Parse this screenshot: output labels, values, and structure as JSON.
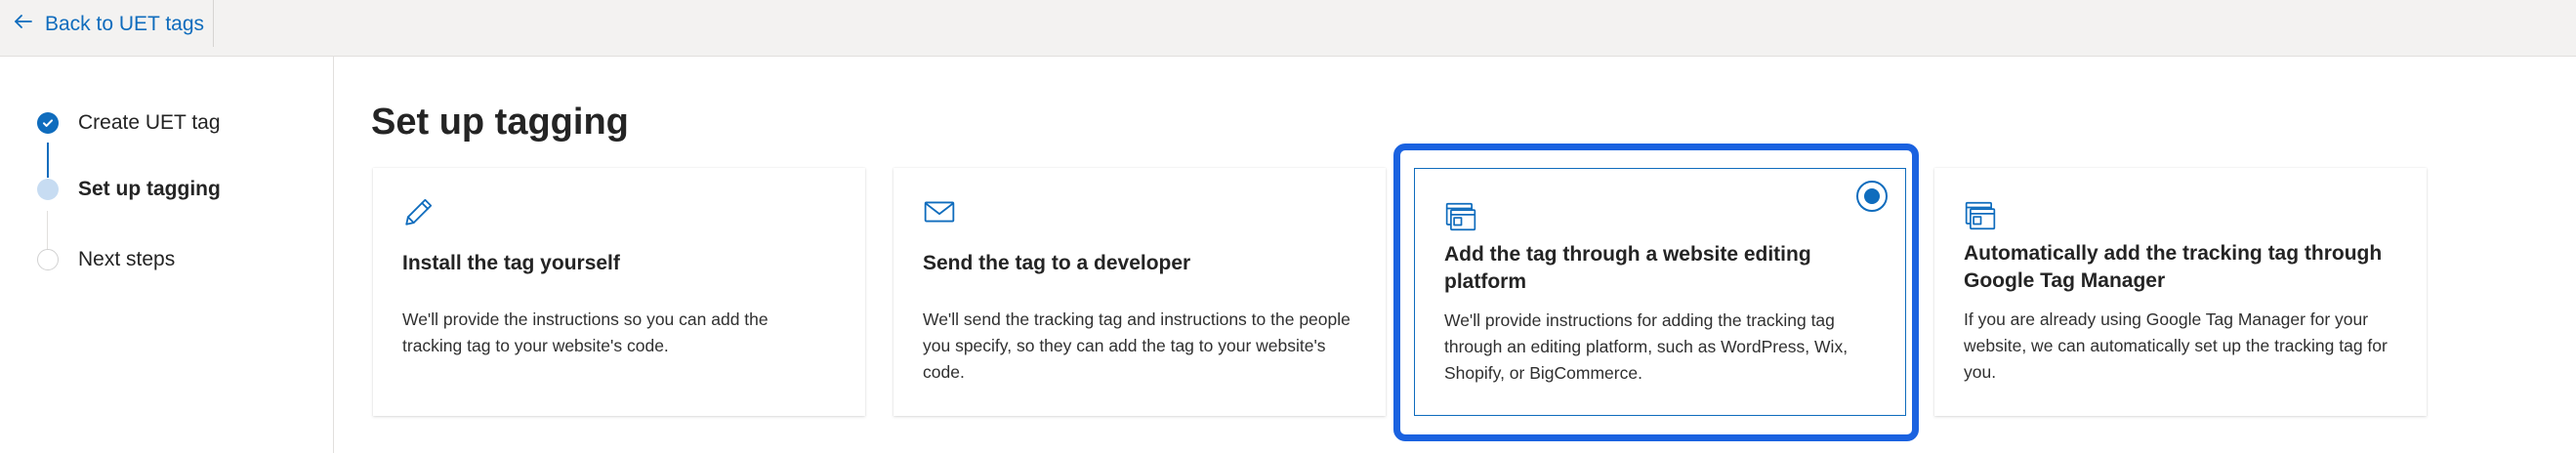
{
  "topbar": {
    "back_label": "Back to UET tags"
  },
  "stepper": {
    "steps": [
      {
        "label": "Create UET tag",
        "state": "done"
      },
      {
        "label": "Set up tagging",
        "state": "current"
      },
      {
        "label": "Next steps",
        "state": "pending"
      }
    ]
  },
  "main": {
    "title": "Set up tagging",
    "options": [
      {
        "icon": "pencil-icon",
        "title": "Install the tag yourself",
        "description": "We'll provide the instructions so you can add the tracking tag to your website's code.",
        "selected": false
      },
      {
        "icon": "mail-icon",
        "title": "Send the tag to a developer",
        "description": "We'll send the tracking tag and instructions to the people you specify, so they can add the tag to your website's code.",
        "selected": false
      },
      {
        "icon": "browser-windows-icon",
        "title": "Add the tag through a website editing platform",
        "description": "We'll provide instructions for adding the tracking tag through an editing platform, such as WordPress, Wix, Shopify, or BigCommerce.",
        "selected": true
      },
      {
        "icon": "browser-windows-icon",
        "title": "Automatically add the tracking tag through Google Tag Manager",
        "description": "If you are already using Google Tag Manager for your website, we can automatically set up the tracking tag for you.",
        "selected": false
      }
    ]
  },
  "colors": {
    "accent": "#0f6cbd",
    "selection_outline": "#1a62e0",
    "step_current": "#c7dcf2"
  }
}
